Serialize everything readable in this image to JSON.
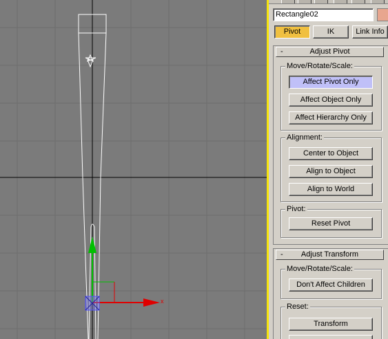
{
  "viewport": {
    "axis_x_label": "x",
    "colors": {
      "background": "#7b7b7b",
      "grid": "#6a6a6a",
      "axis_line": "#000000",
      "object_outline": "#ffffff",
      "gizmo_x": "#e00000",
      "gizmo_y": "#00c000",
      "pivot_box": "#5050ff"
    }
  },
  "panel": {
    "object_name": "Rectangle02",
    "object_color": "#e8a68e",
    "tabs": [
      {
        "label": "Pivot",
        "active": true
      },
      {
        "label": "IK",
        "active": false
      },
      {
        "label": "Link Info",
        "active": false
      }
    ],
    "adjust_pivot": {
      "title": "Adjust Pivot",
      "collapse_symbol": "-",
      "move_group": {
        "label": "Move/Rotate/Scale:",
        "buttons": [
          "Affect Pivot Only",
          "Affect Object Only",
          "Affect Hierarchy Only"
        ]
      },
      "alignment_group": {
        "label": "Alignment:",
        "buttons": [
          "Center to Object",
          "Align to Object",
          "Align to World"
        ]
      },
      "pivot_group": {
        "label": "Pivot:",
        "buttons": [
          "Reset Pivot"
        ]
      }
    },
    "adjust_transform": {
      "title": "Adjust Transform",
      "collapse_symbol": "-",
      "move_group": {
        "label": "Move/Rotate/Scale:",
        "buttons": [
          "Don't Affect Children"
        ]
      },
      "reset_group": {
        "label": "Reset:",
        "buttons": [
          "Transform"
        ]
      }
    }
  }
}
